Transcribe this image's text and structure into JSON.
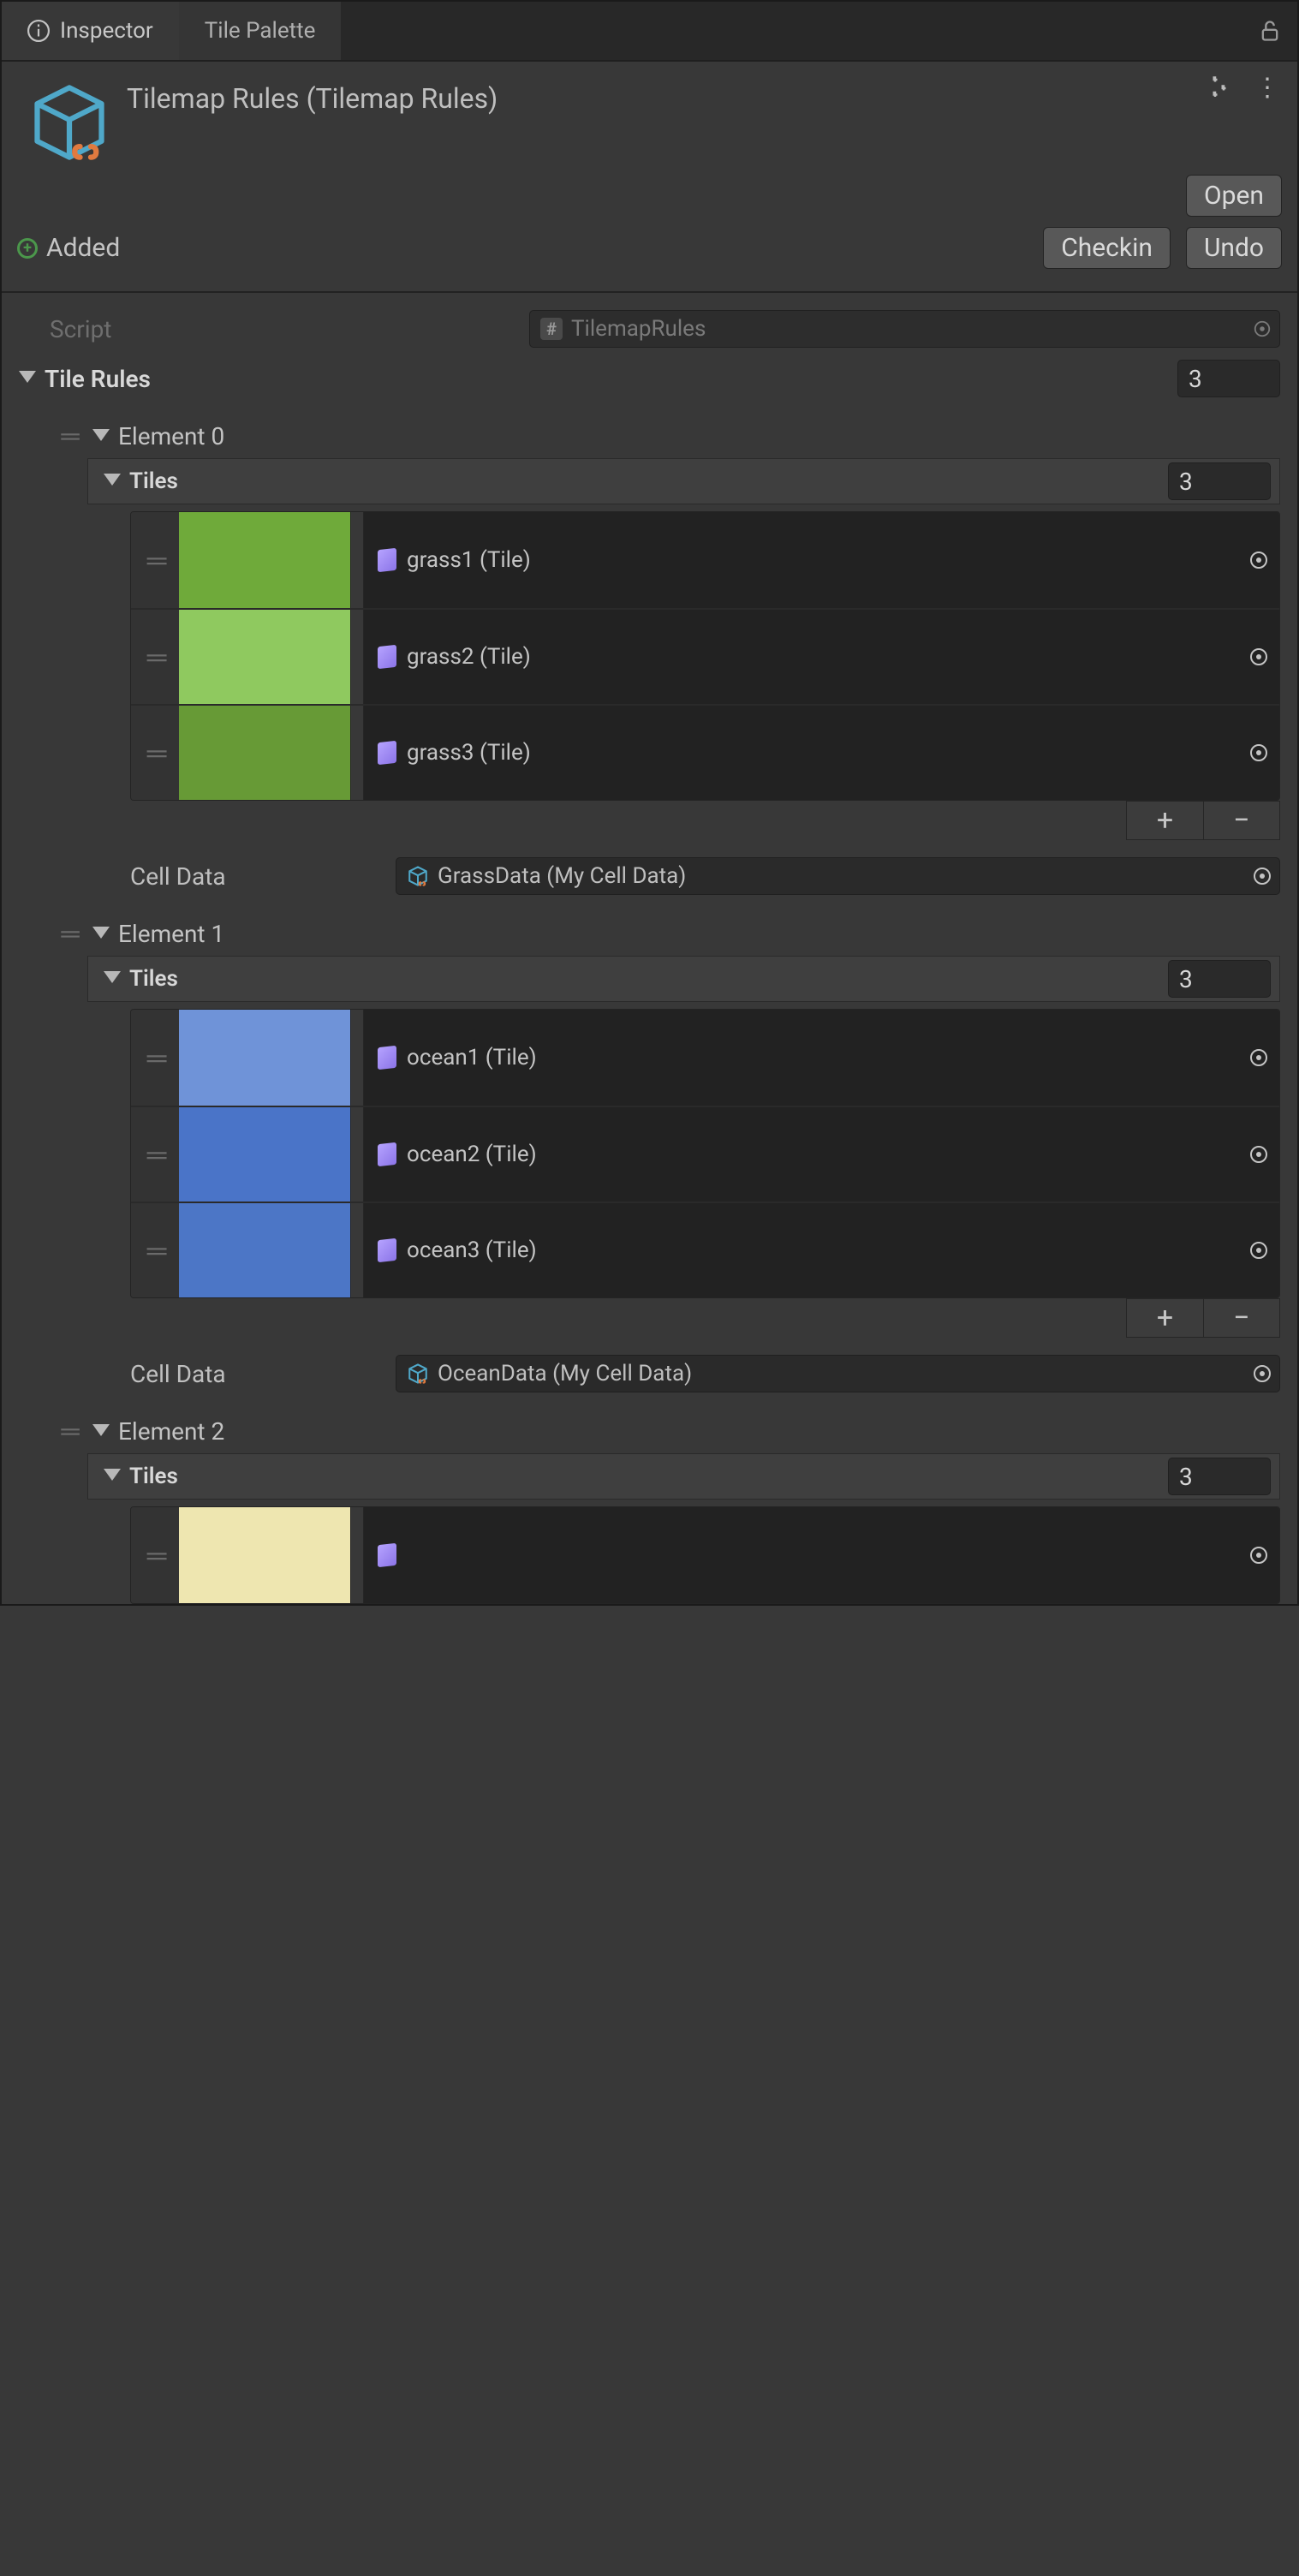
{
  "tabs": {
    "inspector": "Inspector",
    "tilePalette": "Tile Palette"
  },
  "header": {
    "title": "Tilemap Rules (Tilemap Rules)",
    "open": "Open"
  },
  "vcs": {
    "added": "Added",
    "checkin": "Checkin",
    "undo": "Undo"
  },
  "script": {
    "label": "Script",
    "value": "TilemapRules"
  },
  "tileRules": {
    "label": "Tile Rules",
    "count": "3"
  },
  "elements": [
    {
      "name": "Element 0",
      "tilesLabel": "Tiles",
      "tilesCount": "3",
      "tiles": [
        {
          "label": "grass1 (Tile)",
          "color": "#6faa3a"
        },
        {
          "label": "grass2 (Tile)",
          "color": "#8fc95f"
        },
        {
          "label": "grass3 (Tile)",
          "color": "#679a36"
        }
      ],
      "cellDataLabel": "Cell Data",
      "cellDataValue": "GrassData (My Cell Data)"
    },
    {
      "name": "Element 1",
      "tilesLabel": "Tiles",
      "tilesCount": "3",
      "tiles": [
        {
          "label": "ocean1 (Tile)",
          "color": "#6f93d8"
        },
        {
          "label": "ocean2 (Tile)",
          "color": "#4a74c8"
        },
        {
          "label": "ocean3 (Tile)",
          "color": "#4c76c6"
        }
      ],
      "cellDataLabel": "Cell Data",
      "cellDataValue": "OceanData (My Cell Data)"
    },
    {
      "name": "Element 2",
      "tilesLabel": "Tiles",
      "tilesCount": "3",
      "tiles": [
        {
          "label": "",
          "color": "#eee6b0"
        }
      ],
      "cellDataLabel": "",
      "cellDataValue": ""
    }
  ]
}
